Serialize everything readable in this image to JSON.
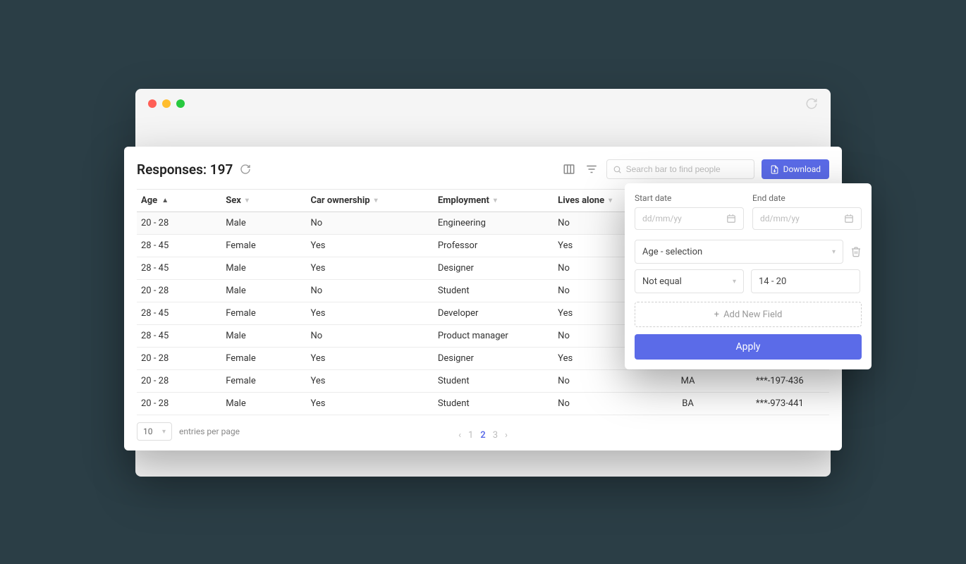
{
  "header": {
    "title_prefix": "Responses:",
    "count": "197"
  },
  "toolbar": {
    "search_placeholder": "Search bar to find people",
    "download_label": "Download"
  },
  "columns": [
    {
      "label": "Age",
      "sort": "asc"
    },
    {
      "label": "Sex",
      "sort": "none"
    },
    {
      "label": "Car ownership",
      "sort": "none"
    },
    {
      "label": "Employment",
      "sort": "none"
    },
    {
      "label": "Lives alone",
      "sort": "none"
    },
    {
      "label": "",
      "sort": "hidden"
    },
    {
      "label": "",
      "sort": "hidden"
    }
  ],
  "rows": [
    {
      "age": "20 - 28",
      "sex": "Male",
      "car": "No",
      "emp": "Engineering",
      "alone": "No",
      "edu": "",
      "ssn": ""
    },
    {
      "age": "28 - 45",
      "sex": "Female",
      "car": "Yes",
      "emp": "Professor",
      "alone": "Yes",
      "edu": "",
      "ssn": ""
    },
    {
      "age": "28 - 45",
      "sex": "Male",
      "car": "Yes",
      "emp": "Designer",
      "alone": "No",
      "edu": "",
      "ssn": ""
    },
    {
      "age": "20 - 28",
      "sex": "Male",
      "car": "No",
      "emp": "Student",
      "alone": "No",
      "edu": "",
      "ssn": ""
    },
    {
      "age": "28 - 45",
      "sex": "Female",
      "car": "Yes",
      "emp": "Developer",
      "alone": "Yes",
      "edu": "",
      "ssn": ""
    },
    {
      "age": "28 - 45",
      "sex": "Male",
      "car": "No",
      "emp": "Product manager",
      "alone": "No",
      "edu": "",
      "ssn": ""
    },
    {
      "age": "20 - 28",
      "sex": "Female",
      "car": "Yes",
      "emp": "Designer",
      "alone": "Yes",
      "edu": "",
      "ssn": ""
    },
    {
      "age": "20 - 28",
      "sex": "Female",
      "car": "Yes",
      "emp": "Student",
      "alone": "No",
      "edu": "MA",
      "ssn": "***-197-436"
    },
    {
      "age": "20 - 28",
      "sex": "Male",
      "car": "Yes",
      "emp": "Student",
      "alone": "No",
      "edu": "BA",
      "ssn": "***-973-441"
    }
  ],
  "pagination": {
    "entries_value": "10",
    "entries_label": "entries per page",
    "pages": [
      "1",
      "2",
      "3"
    ],
    "active": "2"
  },
  "filter": {
    "start_label": "Start date",
    "end_label": "End date",
    "date_placeholder": "dd/mm/yy",
    "field_select": "Age - selection",
    "operator": "Not equal",
    "value": "14 - 20",
    "add_label": "Add New Field",
    "apply_label": "Apply"
  }
}
